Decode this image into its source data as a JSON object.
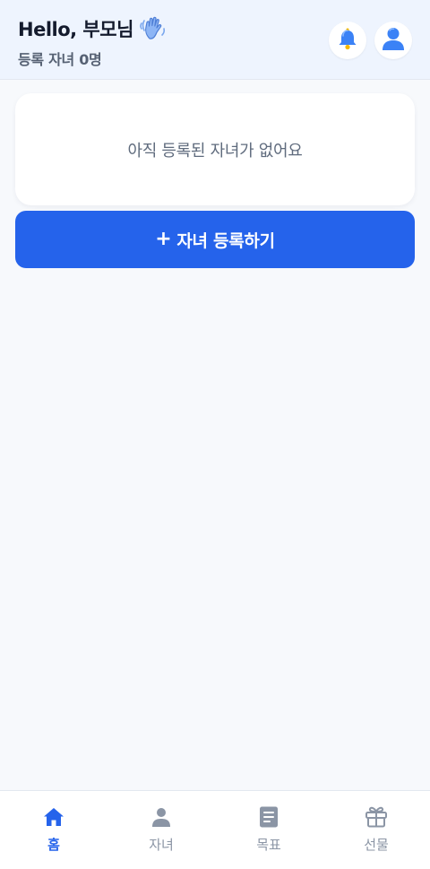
{
  "header": {
    "greeting": "Hello, 부모님",
    "subtitle": "등록 자녀 0명",
    "wave_icon": "waving-hand-icon",
    "bell_icon": "bell-icon",
    "profile_icon": "user-avatar-icon"
  },
  "main": {
    "empty_message": "아직 등록된 자녀가 없어요",
    "register_plus": "+",
    "register_label": "자녀 등록하기"
  },
  "nav": {
    "items": [
      {
        "label": "홈",
        "icon": "home-icon",
        "active": true
      },
      {
        "label": "자녀",
        "icon": "person-icon",
        "active": false
      },
      {
        "label": "목표",
        "icon": "document-icon",
        "active": false
      },
      {
        "label": "선물",
        "icon": "gift-icon",
        "active": false
      }
    ]
  },
  "colors": {
    "accent": "#2563eb",
    "header_bg": "#eef4fe",
    "page_bg": "#f7f9fc",
    "muted": "#8b95a5"
  }
}
